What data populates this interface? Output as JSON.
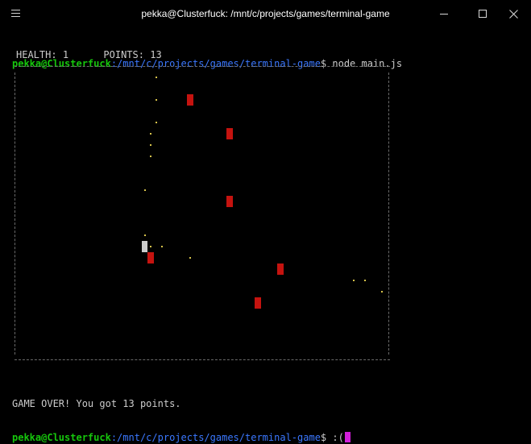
{
  "window": {
    "title": "pekka@Clusterfuck: /mnt/c/projects/games/terminal-game"
  },
  "terminal": {
    "user_host": "pekka@Clusterfuck",
    "path": ":/mnt/c/projects/games/terminal-game",
    "command": "$ node main.js",
    "final_prompt_suffix": "$ :("
  },
  "hud": {
    "health_label": "HEALTH:",
    "health_value": "1",
    "points_label": "POINTS:",
    "points_value": "13"
  },
  "game_over": "GAME OVER! You got 13 points.",
  "colors": {
    "user_host": "#16c60c",
    "path": "#3b78ff",
    "enemy": "#c5130f",
    "cursor": "#d21fd9",
    "background": "#000000"
  },
  "icons": [
    "menu-icon",
    "minimize-icon",
    "maximize-icon",
    "close-icon"
  ]
}
